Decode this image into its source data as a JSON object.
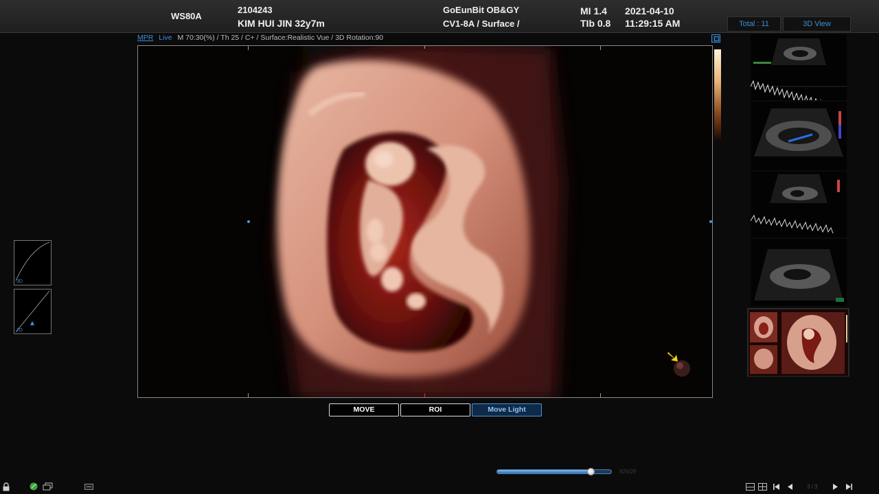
{
  "header": {
    "model": "WS80A",
    "patient_id": "2104243",
    "patient_name": "KIM HUI JIN 32y7m",
    "institution": "GoEunBit OB&GY",
    "probe_preset": "CV1-8A / Surface /",
    "mi": "MI  1.4",
    "tib": "TIb 0.8",
    "date": "2021-04-10",
    "time": "11:29:15 AM",
    "total_label": "Total : 11",
    "view_label": "3D View"
  },
  "info_line": {
    "mpr": "MPR",
    "live": "Live",
    "params": "M 70:30(%) / Th 25 / C+ / Surface:Realistic Vue / 3D Rotation:90"
  },
  "curves": [
    {
      "label": "3D"
    },
    {
      "label": "2D"
    }
  ],
  "buttons": {
    "move": "MOVE",
    "roi": "ROI",
    "move_light": "Move Light"
  },
  "slider": {
    "value_fraction": 0.83,
    "frame_label": "829/29"
  },
  "pagination": {
    "label": "3 / 3"
  },
  "colors": {
    "accent": "#3d8fd8",
    "active_button_border": "#4f96d8",
    "tissue": "#d9a48c"
  },
  "icons": [
    "lock-icon",
    "leaf-icon",
    "window-icon",
    "tape-icon",
    "layout-icon",
    "grid-icon",
    "first-page-icon",
    "prev-page-icon",
    "next-page-icon",
    "last-page-icon"
  ]
}
